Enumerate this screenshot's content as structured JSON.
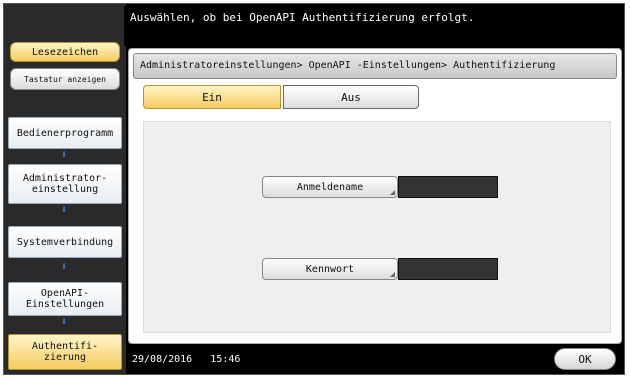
{
  "header": {
    "message": "Auswählen, ob bei OpenAPI Authentifizierung erfolgt."
  },
  "left_panel": {
    "bookmark_label": "Lesezeichen",
    "keyboard_label": "Tastatur anzeigen",
    "nav_items": [
      {
        "label": "Bedienerprogramm"
      },
      {
        "label": "Administrator- einstellung"
      },
      {
        "label": "Systemverbindung"
      },
      {
        "label": "OpenAPI- Einstellungen"
      },
      {
        "label": "Authentifi- zierung",
        "current": true
      }
    ]
  },
  "breadcrumb": "Administratoreinstellungen> OpenAPI -Einstellungen> Authentifizierung",
  "toggle": {
    "on_label": "Ein",
    "off_label": "Aus",
    "selected": "Ein"
  },
  "fields": {
    "username_label": "Anmeldename",
    "username_value": "",
    "password_label": "Kennwort",
    "password_value": ""
  },
  "footer": {
    "date": "29/08/2016",
    "time": "15:46",
    "ok_label": "OK"
  },
  "colors": {
    "selected": "#f5cc60",
    "arrow": "#3a7de0",
    "background": "#000000"
  }
}
